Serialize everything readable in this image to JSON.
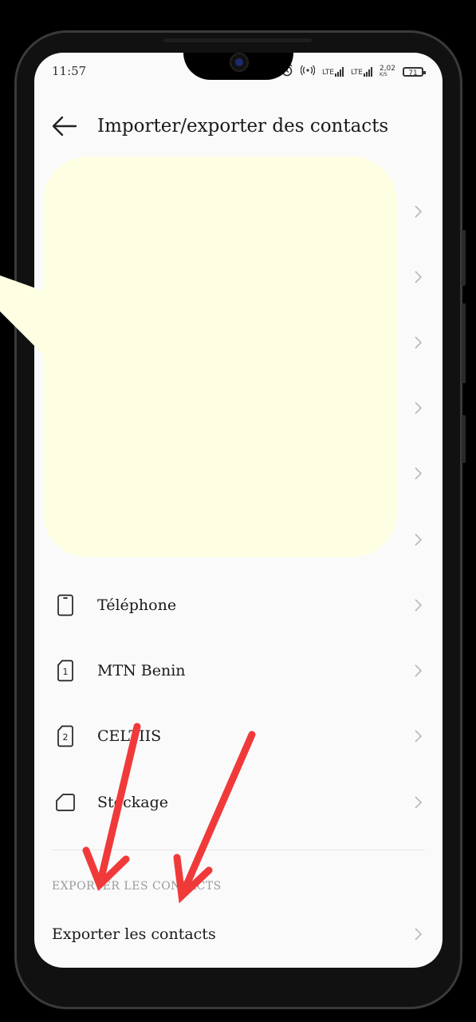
{
  "status_bar": {
    "time": "11:57",
    "network_1": "LTE",
    "network_2": "LTE",
    "speed": "2,02",
    "speed_unit": "K/S",
    "battery": "71"
  },
  "header": {
    "title": "Importer/exporter des contacts"
  },
  "import_sources": [
    {
      "label": "Téléphone",
      "icon": "phone-icon"
    },
    {
      "label": "MTN Benin",
      "icon": "sim-1-icon"
    },
    {
      "label": "CELTIIS",
      "icon": "sim-2-icon"
    },
    {
      "label": "Stockage",
      "icon": "storage-icon"
    }
  ],
  "export_section": {
    "title": "EXPORTER LES CONTACTS",
    "item_label": "Exporter les contacts"
  },
  "colors": {
    "overlay": "#fefee3",
    "arrow": "#f03a3a",
    "background": "#fafafb"
  }
}
